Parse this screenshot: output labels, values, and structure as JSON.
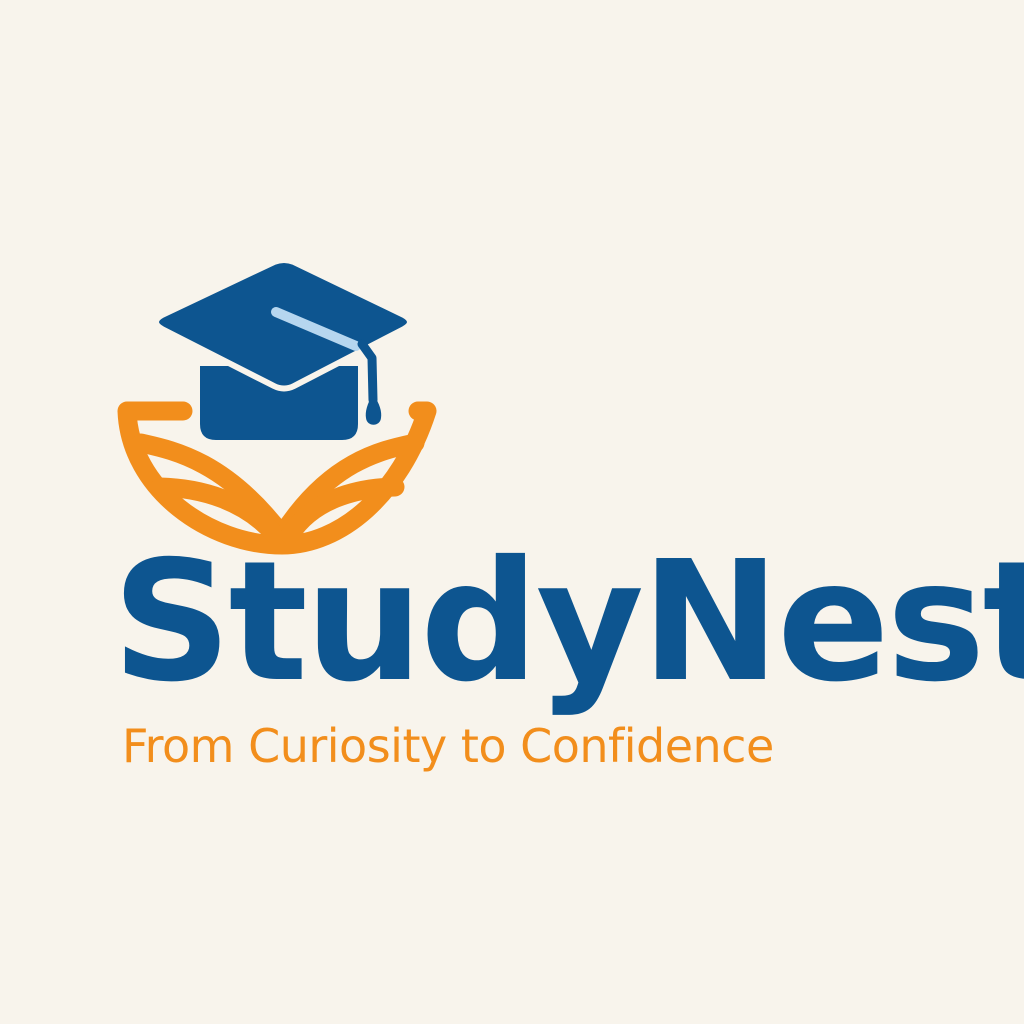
{
  "brand": {
    "name": "StudyNest",
    "tagline": "From Curiosity to Confidence"
  },
  "logo": {
    "icon": "graduation-cap-over-book-icon"
  },
  "colors": {
    "background": "#f8f4ec",
    "primary_blue": "#0d5590",
    "accent_orange": "#f28e1c",
    "cap_highlight": "#b6d6ef"
  }
}
